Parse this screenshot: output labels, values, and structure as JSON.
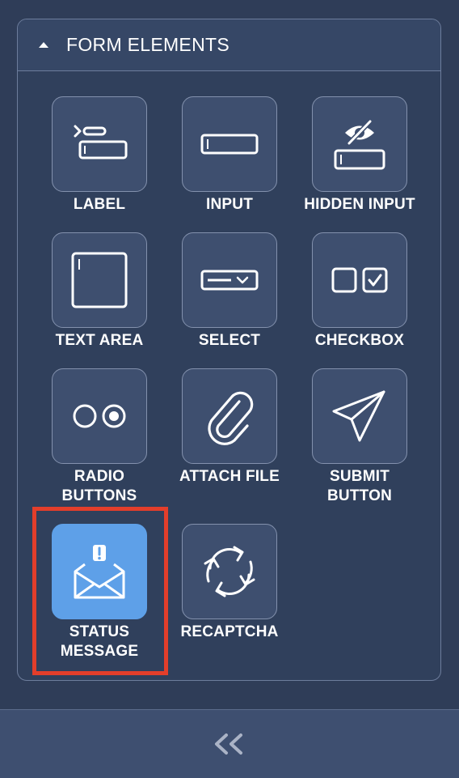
{
  "panel": {
    "title": "FORM ELEMENTS",
    "items": [
      {
        "label_lines": [
          "LABEL"
        ],
        "icon": "label-icon"
      },
      {
        "label_lines": [
          "INPUT"
        ],
        "icon": "input-icon"
      },
      {
        "label_lines": [
          "HIDDEN INPUT"
        ],
        "icon": "hidden-input-icon"
      },
      {
        "label_lines": [
          "TEXT AREA"
        ],
        "icon": "text-area-icon"
      },
      {
        "label_lines": [
          "SELECT"
        ],
        "icon": "select-icon"
      },
      {
        "label_lines": [
          "CHECKBOX"
        ],
        "icon": "checkbox-icon"
      },
      {
        "label_lines": [
          "RADIO",
          "BUTTONS"
        ],
        "icon": "radio-buttons-icon"
      },
      {
        "label_lines": [
          "ATTACH FILE"
        ],
        "icon": "paperclip-icon"
      },
      {
        "label_lines": [
          "SUBMIT",
          "BUTTON"
        ],
        "icon": "paper-plane-icon"
      },
      {
        "label_lines": [
          "STATUS",
          "MESSAGE"
        ],
        "icon": "envelope-alert-icon",
        "selected": true
      },
      {
        "label_lines": [
          "RECAPTCHA"
        ],
        "icon": "recaptcha-icon"
      }
    ]
  },
  "footer": {
    "icon": "double-chevron-left-icon"
  },
  "colors": {
    "background": "#2f3d58",
    "tile": "#3e4f6f",
    "selected_tile": "#5ea0e8",
    "highlight": "#e33e2b"
  }
}
